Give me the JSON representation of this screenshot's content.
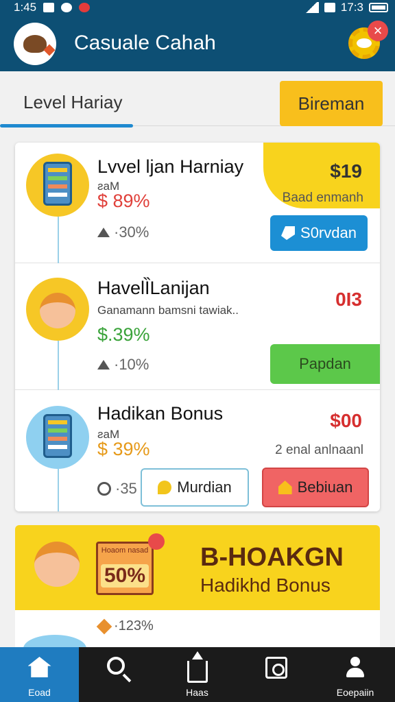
{
  "status_bar": {
    "time_left": "1:45",
    "time_right": "17:3"
  },
  "app_bar": {
    "title": "Casuale Cahah"
  },
  "tabs": {
    "active_label": "Level Hariay",
    "action_button": "Bireman"
  },
  "rows": [
    {
      "title": "Lvvel ljan Harniay",
      "subtitle": "ƨaM",
      "percent": "$ 89%",
      "meta": "·30%",
      "price": "$19",
      "price_sub": "Baad enmanh",
      "button": "S0rvdan"
    },
    {
      "title": "HavelȈLanijan",
      "subtitle": "Ganamann bamsni tawiak..",
      "percent": "$.39%",
      "meta": "·10%",
      "price": "0I3",
      "button": "Papdan"
    },
    {
      "title": "Hadikan Bonus",
      "subtitle": "ƨaM",
      "percent": "$ 39%",
      "meta": "·35",
      "price": "$00",
      "price_sub": "2 enal anlnaanl",
      "button_outline": "Murdian",
      "button_red": "Bebiuan"
    }
  ],
  "promo": {
    "title": "B-HOAKGN",
    "subtitle": "Hadikhd Bonus",
    "sign_top": "Hoaom nasad",
    "sign_percent": "50%",
    "meta": "·123%"
  },
  "bottom_nav": [
    {
      "label": "Eoad",
      "icon": "home-icon"
    },
    {
      "label": "",
      "icon": "search-icon"
    },
    {
      "label": "Haas",
      "icon": "upload-icon"
    },
    {
      "label": "",
      "icon": "camera-icon"
    },
    {
      "label": "Eoepaiin",
      "icon": "user-icon"
    }
  ],
  "colors": {
    "primary": "#0d4f74",
    "accent": "#f8bf1c",
    "nav_active": "#1f7cc0"
  }
}
